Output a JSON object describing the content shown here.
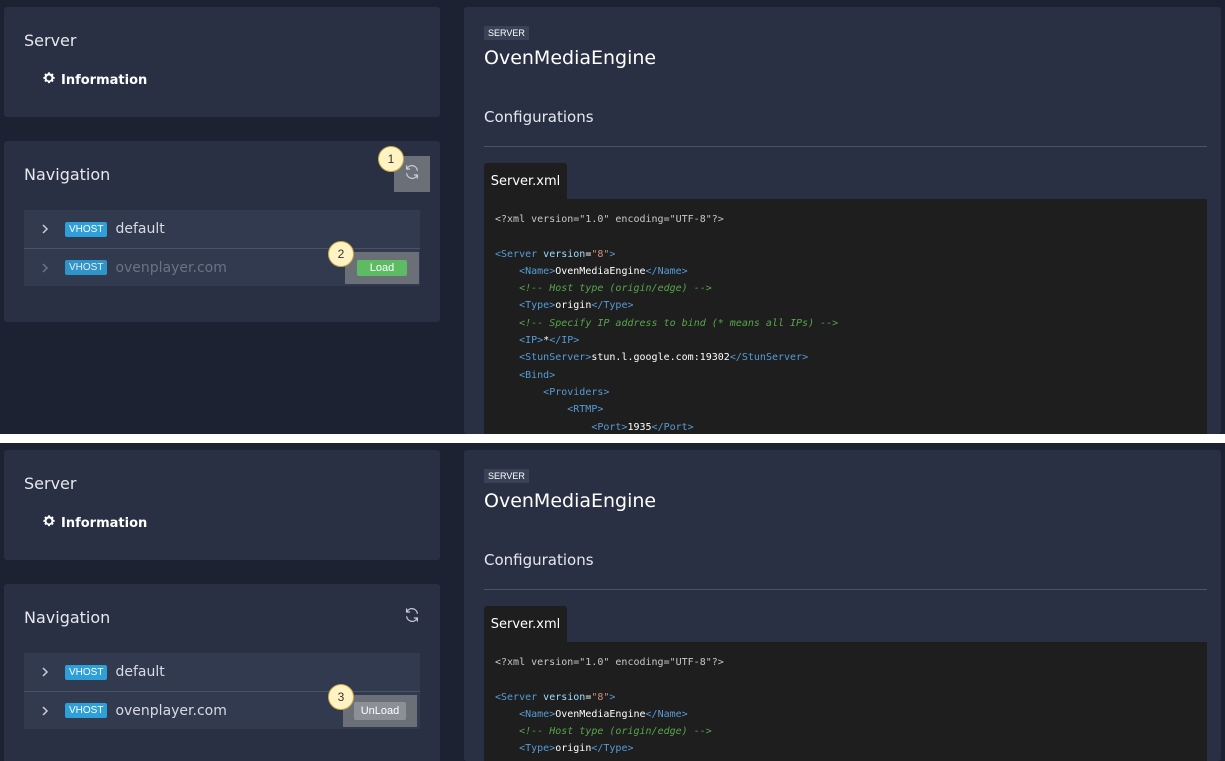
{
  "server_card": {
    "title": "Server",
    "info_label": "Information"
  },
  "navigation": {
    "title": "Navigation"
  },
  "vhosts_top": [
    {
      "badge": "VHOST",
      "name": "default",
      "dim": false,
      "action": ""
    },
    {
      "badge": "VHOST",
      "name": "ovenplayer.com",
      "dim": true,
      "action": "Load"
    }
  ],
  "vhosts_bottom": [
    {
      "badge": "VHOST",
      "name": "default",
      "dim": false,
      "action": ""
    },
    {
      "badge": "VHOST",
      "name": "ovenplayer.com",
      "dim": false,
      "action": "UnLoad"
    }
  ],
  "main": {
    "tag": "SERVER",
    "title": "OvenMediaEngine",
    "section": "Configurations",
    "file_tab": "Server.xml"
  },
  "callouts": {
    "c1": "1",
    "c2": "2",
    "c3": "3"
  },
  "code_lines": [
    [
      [
        "pi",
        "<?xml version=\"1.0\" encoding=\"UTF-8\"?>"
      ]
    ],
    [],
    [
      [
        "tag",
        "<Server "
      ],
      [
        "attr",
        "version"
      ],
      [
        "txt",
        "="
      ],
      [
        "str",
        "\"8\""
      ],
      [
        "tag",
        ">"
      ]
    ],
    [
      [
        "txt",
        "    "
      ],
      [
        "tag",
        "<Name>"
      ],
      [
        "txt",
        "OvenMediaEngine"
      ],
      [
        "tag",
        "</Name>"
      ]
    ],
    [
      [
        "txt",
        "    "
      ],
      [
        "com",
        "<!-- Host type (origin/edge) -->"
      ]
    ],
    [
      [
        "txt",
        "    "
      ],
      [
        "tag",
        "<Type>"
      ],
      [
        "txt",
        "origin"
      ],
      [
        "tag",
        "</Type>"
      ]
    ],
    [
      [
        "txt",
        "    "
      ],
      [
        "com",
        "<!-- Specify IP address to bind (* means all IPs) -->"
      ]
    ],
    [
      [
        "txt",
        "    "
      ],
      [
        "tag",
        "<IP>"
      ],
      [
        "txt",
        "*"
      ],
      [
        "tag",
        "</IP>"
      ]
    ],
    [
      [
        "txt",
        "    "
      ],
      [
        "tag",
        "<StunServer>"
      ],
      [
        "txt",
        "stun.l.google.com:19302"
      ],
      [
        "tag",
        "</StunServer>"
      ]
    ],
    [
      [
        "txt",
        "    "
      ],
      [
        "tag",
        "<Bind>"
      ]
    ],
    [
      [
        "txt",
        "        "
      ],
      [
        "tag",
        "<Providers>"
      ]
    ],
    [
      [
        "txt",
        "            "
      ],
      [
        "tag",
        "<RTMP>"
      ]
    ],
    [
      [
        "txt",
        "                "
      ],
      [
        "tag",
        "<Port>"
      ],
      [
        "txt",
        "1935"
      ],
      [
        "tag",
        "</Port>"
      ]
    ]
  ],
  "code_lines_bottom_count": 6,
  "colors": {
    "panel": "#293043",
    "background": "#1c2232",
    "badge": "#2e9fd8",
    "load": "#5dbb63",
    "unload": "#8c8f96"
  }
}
